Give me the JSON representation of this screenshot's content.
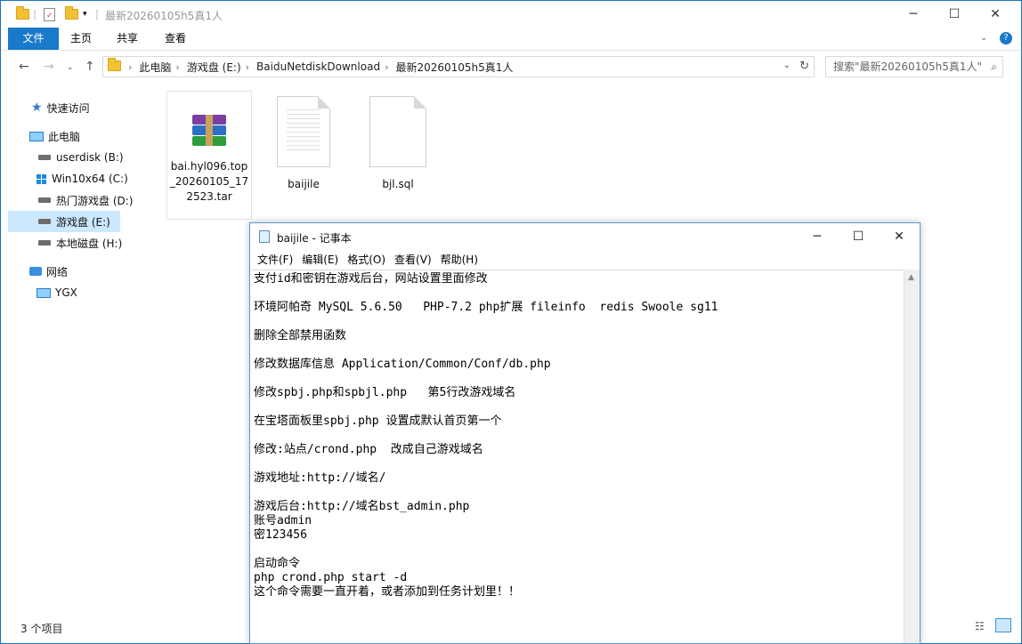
{
  "explorer": {
    "window_title": "最新20260105h5真1人",
    "ribbon_tabs": [
      "文件",
      "主页",
      "共享",
      "查看"
    ],
    "breadcrumb": [
      "此电脑",
      "游戏盘 (E:)",
      "BaiduNetdiskDownload",
      "最新20260105h5真1人"
    ],
    "search_placeholder": "搜索\"最新20260105h5真1人\"",
    "nav": {
      "quick_access": "快速访问",
      "this_pc": "此电脑",
      "drives": [
        "userdisk (B:)",
        "Win10x64 (C:)",
        "热门游戏盘 (D:)",
        "游戏盘 (E:)",
        "本地磁盘 (H:)"
      ],
      "network": "网络",
      "ygx": "YGX"
    },
    "files": [
      {
        "name": "bai.hyl096.top_20260105_172523.tar",
        "icon": "winrar-archive-icon"
      },
      {
        "name": "baijile",
        "icon": "text-document-icon"
      },
      {
        "name": "bjl.sql",
        "icon": "blank-file-icon"
      }
    ],
    "status": "3 个项目"
  },
  "notepad": {
    "title": "baijile - 记事本",
    "menu": [
      "文件(F)",
      "编辑(E)",
      "格式(O)",
      "查看(V)",
      "帮助(H)"
    ],
    "content": "支付id和密钥在游戏后台，网站设置里面修改\n\n环境阿帕奇 MySQL 5.6.50   PHP-7.2 php扩展 fileinfo  redis Swoole sg11\n\n删除全部禁用函数\n\n修改数据库信息 Application/Common/Conf/db.php\n\n修改spbj.php和spbjl.php   第5行改游戏域名\n\n在宝塔面板里spbj.php 设置成默认首页第一个\n\n修改:站点/crond.php  改成自己游戏域名\n\n游戏地址:http://域名/\n\n游戏后台:http://域名bst_admin.php\n账号admin\n密123456\n\n启动命令\nphp crond.php start -d\n这个命令需要一直开着，或者添加到任务计划里！！"
  },
  "colors": {
    "accent": "#1979ca",
    "selection": "#cce8ff"
  }
}
